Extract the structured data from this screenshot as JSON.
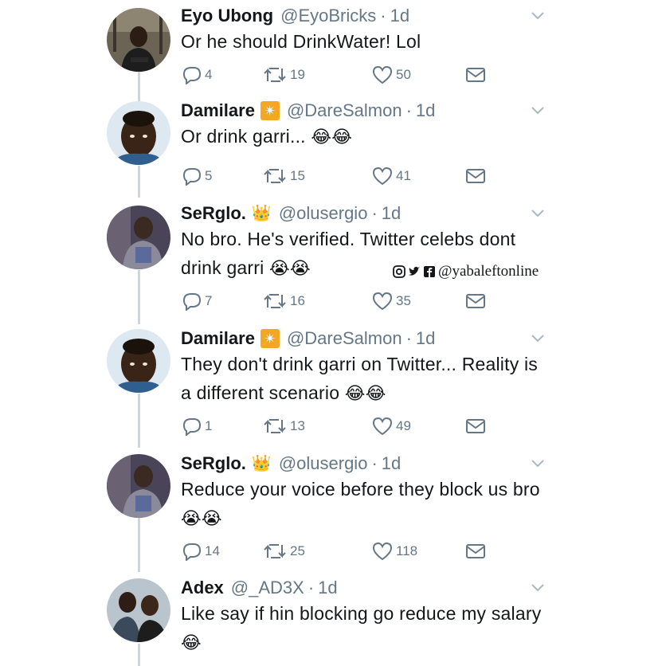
{
  "watermark": {
    "text": "@yabaleftonline"
  },
  "tweets": [
    {
      "name": "Eyo Ubong",
      "handle": "@EyoBricks",
      "time": "1d",
      "badge": "",
      "text": "Or he should DrinkWater! Lol",
      "emoji": "",
      "replies": "4",
      "retweets": "19",
      "likes": "50"
    },
    {
      "name": "Damilare",
      "badge": "✴",
      "handle": "@DareSalmon",
      "time": "1d",
      "text": "Or drink garri... ",
      "emoji": "😂😂",
      "replies": "5",
      "retweets": "15",
      "likes": "41"
    },
    {
      "name": "SeRglo.",
      "badge": "👑",
      "handle": "@olusergio",
      "time": "1d",
      "text": "No bro. He's verified. Twitter celebs dont drink garri ",
      "emoji": "😭😭",
      "replies": "7",
      "retweets": "16",
      "likes": "35"
    },
    {
      "name": "Damilare",
      "badge": "✴",
      "handle": "@DareSalmon",
      "time": "1d",
      "text": "They don't drink garri on Twitter... Reality is a different scenario ",
      "emoji": "😂😂",
      "replies": "1",
      "retweets": "13",
      "likes": "49"
    },
    {
      "name": "SeRglo.",
      "badge": "👑",
      "handle": "@olusergio",
      "time": "1d",
      "text": "Reduce your voice before they block us bro ",
      "emoji": "😭😭",
      "replies": "14",
      "retweets": "25",
      "likes": "118"
    },
    {
      "name": "Adex",
      "badge": "",
      "handle": "@_AD3X",
      "time": "1d",
      "text": "Like say if hin blocking go reduce my salary ",
      "emoji": "😂",
      "replies": "",
      "retweets": "",
      "likes": ""
    }
  ],
  "icons": {
    "reply": "reply-icon",
    "retweet": "retweet-icon",
    "like": "heart-icon",
    "dm": "envelope-icon",
    "caret": "chevron-down-icon"
  },
  "colors": {
    "text": "#14171a",
    "secondary": "#657786",
    "thread": "#ccd6dd",
    "badge": "#f5a623"
  }
}
